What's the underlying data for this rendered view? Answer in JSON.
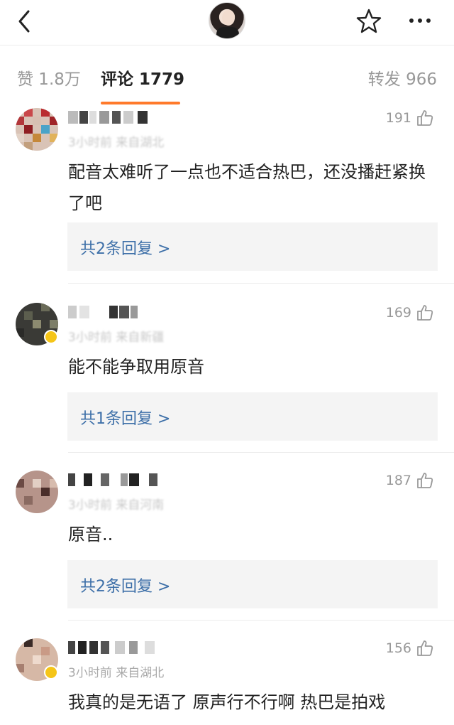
{
  "header": {
    "back_icon": "chevron-left-icon",
    "favorite_icon": "star-outline-icon",
    "more_icon": "ellipsis-icon"
  },
  "tabs": {
    "likes": "赞 1.8万",
    "comments": "评论 1779",
    "reposts": "转发 966",
    "active": "comments",
    "accent": "#ff7a2b"
  },
  "comments": [
    {
      "meta": "3小时前 来自湖北",
      "likes": "191",
      "text": "配音太难听了一点也不适合热巴，还没播赶紧换了吧",
      "reply": "共2条回复 >"
    },
    {
      "meta": "3小时前 来自新疆",
      "likes": "169",
      "text": "能不能争取用原音",
      "reply": "共1条回复 >"
    },
    {
      "meta": "3小时前 来自河南",
      "likes": "187",
      "text": "原音..",
      "reply": "共2条回复 >"
    },
    {
      "meta": "3小时前 来自湖北",
      "likes": "156",
      "text": "我真的是无语了 原声行不行啊 热巴是拍戏",
      "reply": ""
    }
  ],
  "colors": {
    "link": "#3d6fa8",
    "muted": "#999999",
    "reply_bg": "#f4f4f4"
  }
}
